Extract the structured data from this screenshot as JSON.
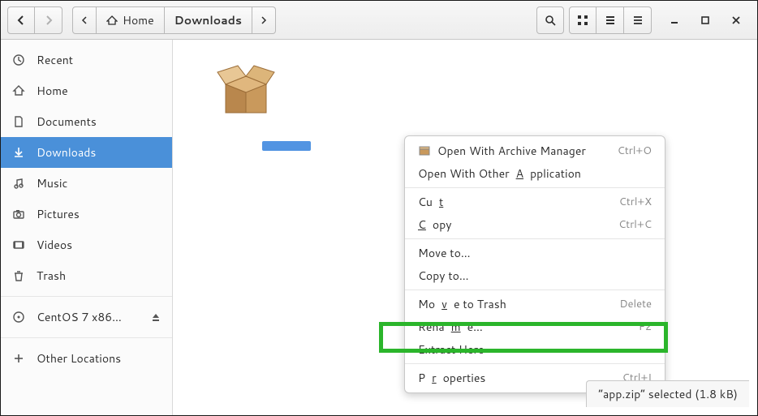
{
  "pathbar": {
    "home": "Home",
    "current": "Downloads"
  },
  "sidebar": {
    "items": [
      {
        "label": "Recent"
      },
      {
        "label": "Home"
      },
      {
        "label": "Documents"
      },
      {
        "label": "Downloads"
      },
      {
        "label": "Music"
      },
      {
        "label": "Pictures"
      },
      {
        "label": "Videos"
      },
      {
        "label": "Trash"
      }
    ],
    "device": {
      "label": "CentOS 7 x86…"
    },
    "other": {
      "label": "Other Locations"
    }
  },
  "file": {
    "name": "app.zip"
  },
  "contextmenu": {
    "items": [
      {
        "label": "Open With Archive Manager",
        "shortcut": "Ctrl+O",
        "icon": true
      },
      {
        "label_html": "Open With Other <u>A</u>pplication"
      },
      {
        "sep": true
      },
      {
        "label_html": "Cu<u>t</u>",
        "shortcut": "Ctrl+X"
      },
      {
        "label_html": "<u>C</u>opy",
        "shortcut": "Ctrl+C"
      },
      {
        "sep": true
      },
      {
        "label": "Move to…"
      },
      {
        "label": "Copy to…"
      },
      {
        "sep": true
      },
      {
        "label_html": "Mo<u>v</u>e to Trash",
        "shortcut": "Delete"
      },
      {
        "label_html": "Rena<u>m</u>e…",
        "shortcut": "F2"
      },
      {
        "label": "Extract Here"
      },
      {
        "sep": true
      },
      {
        "label_html": "P<u>r</u>operties",
        "shortcut": "Ctrl+I"
      }
    ]
  },
  "statusbar": {
    "text": "“app.zip” selected  (1.8 kB)"
  }
}
